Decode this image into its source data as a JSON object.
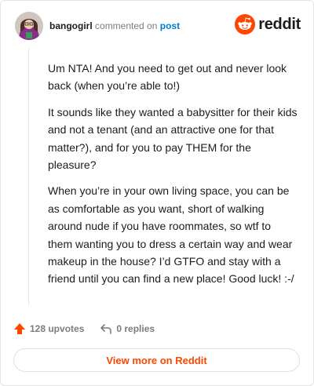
{
  "comment": {
    "username": "bangogirl",
    "action_text": "commented on",
    "target_link": "post",
    "paragraphs": [
      "Um NTA! And you need to get out and never look back (when you’re able to!)",
      "It sounds like they wanted a babysitter for their kids and not a tenant (and an attractive one for that matter?), and for you to pay THEM for the pleasure?",
      "When you’re in your own living space, you can be as comfortable as you want, short of walking around nude if you have roommates, so wtf to them wanting you to dress a certain way and wear makeup in the house? I’d GTFO and stay with a friend until you can find a new place! Good luck! :-/"
    ]
  },
  "brand": {
    "name": "reddit",
    "icon": "reddit-snoo-icon",
    "accent_color": "#ff4500"
  },
  "actions": {
    "upvotes_label": "128 upvotes",
    "upvote_icon": "upvote-arrow-icon",
    "replies_label": "0 replies",
    "reply_icon": "reply-icon"
  },
  "view_more": {
    "label": "View more on Reddit"
  },
  "colors": {
    "link": "#0079d3",
    "upvote": "#ff4500",
    "text": "#1c1c1c",
    "muted": "#7c7c7c"
  }
}
